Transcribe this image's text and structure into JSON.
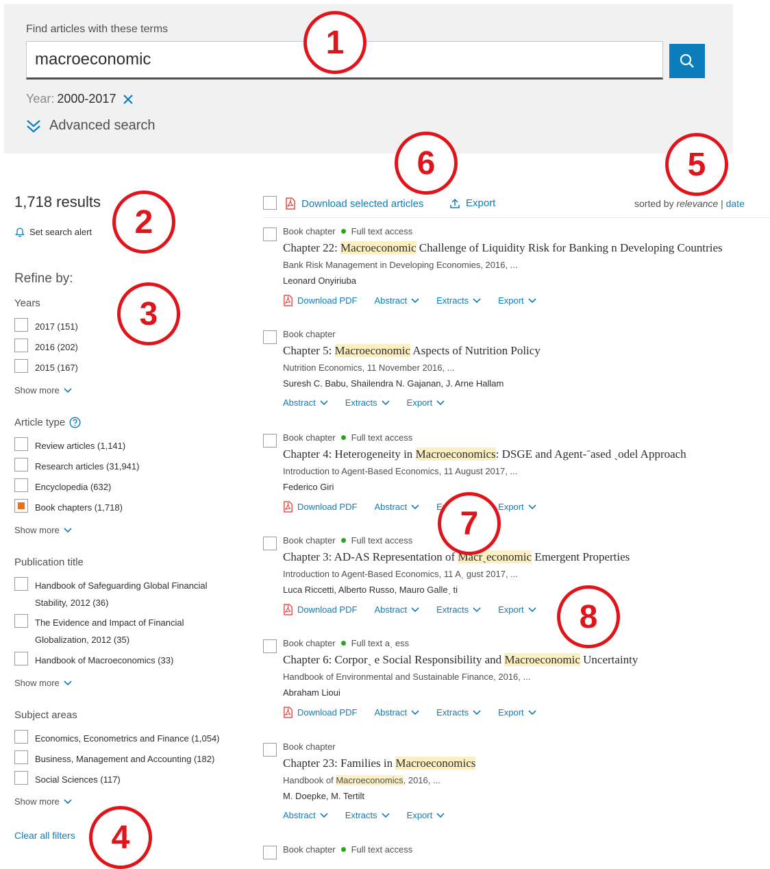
{
  "search": {
    "label": "Find articles with these terms",
    "value": "macroeconomic",
    "year_label": "Year:",
    "year_value": "2000-2017",
    "advanced_label": "Advanced search"
  },
  "summary": {
    "results_count": "1,718 results",
    "alert_label": "Set search alert"
  },
  "refine": {
    "title": "Refine by:",
    "show_more": "Show more",
    "clear_all": "Clear all filters",
    "years": {
      "title": "Years",
      "items": [
        {
          "label": "2017 (151)",
          "checked": false
        },
        {
          "label": "2016 (202)",
          "checked": false
        },
        {
          "label": "2015 (167)",
          "checked": false
        }
      ]
    },
    "article_type": {
      "title": "Article type",
      "items": [
        {
          "label": "Review articles (1,141)",
          "checked": false
        },
        {
          "label": "Research articles (31,941)",
          "checked": false
        },
        {
          "label": "Encyclopedia (632)",
          "checked": false
        },
        {
          "label": "Book chapters (1,718)",
          "checked": true
        }
      ]
    },
    "publication_title": {
      "title": "Publication title",
      "items": [
        {
          "label": "Handbook of Safeguarding Global Financial Stability, 2012 (36)",
          "checked": false
        },
        {
          "label": "The Evidence and Impact of Financial Globalization, 2012 (35)",
          "checked": false
        },
        {
          "label": "Handbook of Macroeconomics (33)",
          "checked": false
        }
      ]
    },
    "subject_areas": {
      "title": "Subject areas",
      "items": [
        {
          "label": "Economics, Econometrics and Finance (1,054)",
          "checked": false
        },
        {
          "label": "Business, Management and Accounting (182)",
          "checked": false
        },
        {
          "label": "Social Sciences (117)",
          "checked": false
        }
      ]
    }
  },
  "toolbar": {
    "download_selected": "Download selected articles",
    "export": "Export",
    "sorted_by": "sorted by",
    "relevance": "relevance",
    "separator": "|",
    "date": "date"
  },
  "results": [
    {
      "type": "Book chapter",
      "access": "Full text access",
      "title_pre": "Chapter 22: ",
      "title_hl": "Macroeconomic",
      "title_post": " Challenge of Liquidity Risk for Banking  n Developing Countries",
      "source_pre": "Bank Risk Management in Developing Economies, 2016, ...",
      "source_hl": "",
      "source_post": "",
      "authors": "Leonard Onyiriuba",
      "actions": {
        "pdf": "Download PDF",
        "abstract": "Abstract",
        "extracts": "Extracts",
        "export": "Export"
      }
    },
    {
      "type": "Book chapter",
      "access": "",
      "title_pre": "Chapter 5: ",
      "title_hl": "Macroeconomic",
      "title_post": " Aspects of Nutrition Policy",
      "source_pre": "Nutrition Economics, 11 November 2016, ...",
      "source_hl": "",
      "source_post": "",
      "authors": "Suresh C. Babu, Shailendra N. Gajanan, J. Arne Hallam",
      "actions": {
        "pdf": "",
        "abstract": "Abstract",
        "extracts": "Extracts",
        "export": "Export"
      }
    },
    {
      "type": "Book chapter",
      "access": "Full text access",
      "title_pre": "Chapter 4: Heterogeneity in ",
      "title_hl": "Macroeconomics",
      "title_post": ": DSGE and Agent-ˉased ˎodel Approach",
      "source_pre": "Introduction to Agent-Based Economics, 11 August 2017, ...",
      "source_hl": "",
      "source_post": "",
      "authors": "Federico Giri",
      "actions": {
        "pdf": "Download PDF",
        "abstract": "Abstract",
        "extracts": "Extracts",
        "export": "Export"
      }
    },
    {
      "type": "Book chapter",
      "access": "Full text access",
      "title_pre": "Chapter 3: AD-AS Representation of ",
      "title_hl": "Macrˎeconomic",
      "title_post": " Emergent Properties",
      "source_pre": "Introduction to Agent-Based Economics, 11 Aˎ gust 2017, ...",
      "source_hl": "",
      "source_post": "",
      "authors": "Luca Riccetti, Alberto Russo, Mauro Galleˏ ti",
      "actions": {
        "pdf": "Download PDF",
        "abstract": "Abstract",
        "extracts": "Extracts",
        "export": "Export"
      }
    },
    {
      "type": "Book chapter",
      "access": "Full text aˎ ess",
      "title_pre": "Chapter 6: Corporˎ e Social Responsibility and ",
      "title_hl": "Macroeconomic",
      "title_post": " Uncertainty",
      "source_pre": "Handbook of Environmental and Sustainable Finance, 2016, ...",
      "source_hl": "",
      "source_post": "",
      "authors": "Abraham Lioui",
      "actions": {
        "pdf": "Download PDF",
        "abstract": "Abstract",
        "extracts": "Extracts",
        "export": "Export"
      }
    },
    {
      "type": "Book chapter",
      "access": "",
      "title_pre": "Chapter 23: Families in ",
      "title_hl": "Macroeconomics",
      "title_post": "",
      "source_pre": "Handbook of ",
      "source_hl": "Macroeconomics",
      "source_post": ", 2016, ...",
      "authors": "M. Doepke, M. Tertilt",
      "actions": {
        "pdf": "",
        "abstract": "Abstract",
        "extracts": "Extracts",
        "export": "Export"
      }
    },
    {
      "type": "Book chapter",
      "access": "Full text access",
      "title_pre": "",
      "title_hl": "",
      "title_post": "",
      "source_pre": "",
      "source_hl": "",
      "source_post": "",
      "authors": "",
      "actions": {
        "pdf": "",
        "abstract": "",
        "extracts": "",
        "export": ""
      }
    }
  ],
  "annotations": [
    "1",
    "2",
    "3",
    "4",
    "5",
    "6",
    "7",
    "8"
  ],
  "colors": {
    "accent": "#0c7dbb",
    "checked": "#e9711c",
    "highlight": "#fcf0c2",
    "access_dot": "#29a61b",
    "annotation": "#e0151b"
  }
}
